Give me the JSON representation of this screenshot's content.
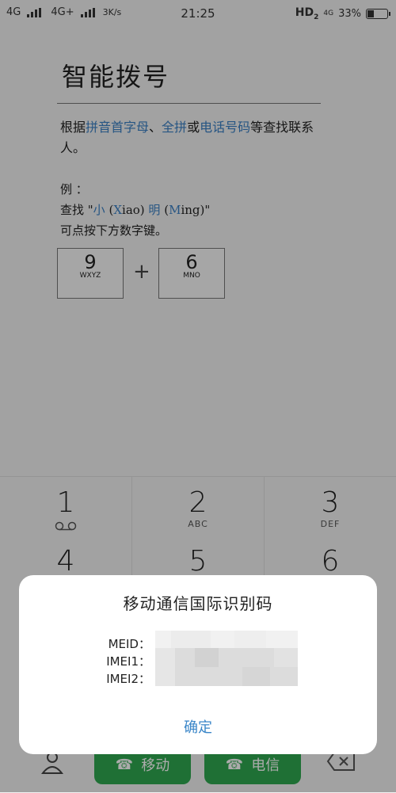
{
  "status_bar": {
    "network_1": "4G",
    "network_2": "4G+",
    "speed": "3K/s",
    "time": "21:25",
    "hd_label": "HD",
    "hd_sub": "2",
    "network_small": "4G",
    "battery_percent": "33%",
    "battery_level": 0.33
  },
  "page": {
    "title": "智能拨号",
    "desc": {
      "p1": "根据",
      "b1": "拼音首字母",
      "p2": "、",
      "b2": "全拼",
      "p3": "或",
      "b3": "电话号码",
      "p4": "等查找联系人。"
    },
    "example": {
      "label": "例 ：",
      "line2_prefix": "查找 \"",
      "char1": "小",
      "pinyin1_prefix": "(",
      "pinyin1_initial": "X",
      "pinyin1_rest": "iao)",
      "char2": "明",
      "pinyin2_prefix": "(",
      "pinyin2_initial": "M",
      "pinyin2_rest": "ing)\"",
      "line3": "可点按下方数字键。"
    },
    "demo_keys": [
      {
        "num": "9",
        "letters": "WXYZ"
      },
      {
        "num": "6",
        "letters": "MNO"
      }
    ],
    "plus": "+"
  },
  "dialpad": {
    "keys": [
      {
        "num": "1",
        "letters": ""
      },
      {
        "num": "2",
        "letters": "ABC"
      },
      {
        "num": "3",
        "letters": "DEF"
      },
      {
        "num": "4",
        "letters": ""
      },
      {
        "num": "5",
        "letters": ""
      },
      {
        "num": "6",
        "letters": ""
      }
    ],
    "call_buttons": [
      {
        "label": "移动"
      },
      {
        "label": "电信"
      }
    ]
  },
  "dialog": {
    "title": "移动通信国际识别码",
    "labels": [
      "MEID：",
      "IMEI1：",
      "IMEI2："
    ],
    "ok_label": "确定"
  },
  "colors": {
    "accent_blue": "#3a86c8",
    "call_green": "#2fa84f"
  }
}
